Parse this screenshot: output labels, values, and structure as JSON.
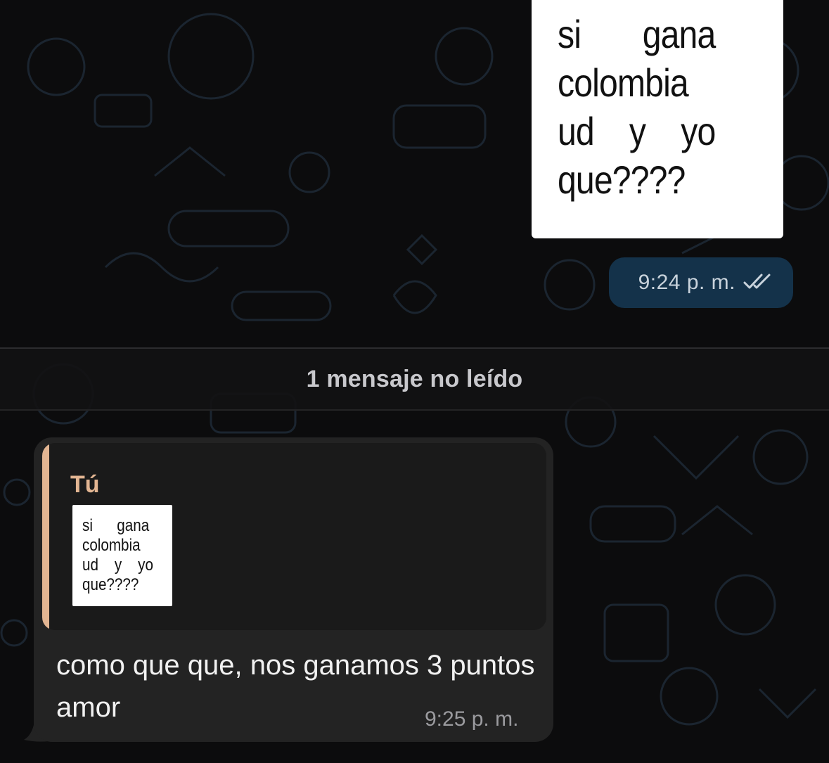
{
  "chat": {
    "outgoing": {
      "image_text": "si       gana\ncolombia\nud    y    yo\nque????",
      "time": "9:24 p. m.",
      "status_icon": "double-check-icon"
    },
    "unread_divider": "1 mensaje no leído",
    "incoming": {
      "reply": {
        "author": "Tú",
        "thumbnail_text": "si      gana\ncolombia\nud    y    yo\nque????"
      },
      "message": "como que que, nos ganamos 3 puntos amor",
      "time": "9:25 p. m."
    }
  },
  "colors": {
    "background": "#0c0c0d",
    "outgoing_time_pill": "#14324a",
    "incoming_bubble": "#232323",
    "reply_accent": "#e2b592"
  }
}
